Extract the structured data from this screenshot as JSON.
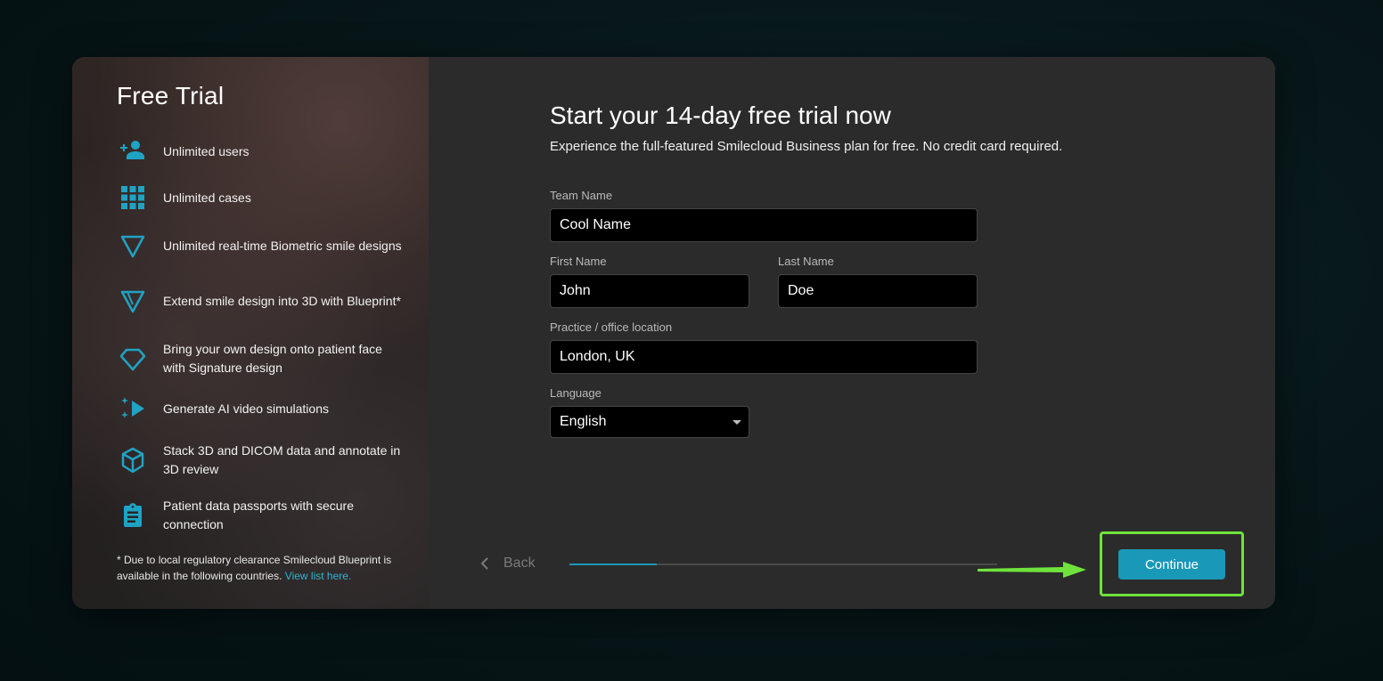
{
  "sidebar": {
    "title": "Free Trial",
    "features": [
      {
        "icon": "add-user-icon",
        "label": "Unlimited users"
      },
      {
        "icon": "grid-icon",
        "label": "Unlimited cases"
      },
      {
        "icon": "triangle-icon",
        "label": "Unlimited real-time Biometric smile designs"
      },
      {
        "icon": "blueprint-triangle-icon",
        "label": "Extend smile design into 3D with Blueprint*"
      },
      {
        "icon": "diamond-icon",
        "label": "Bring your own design onto patient face with Signature design"
      },
      {
        "icon": "sparkle-play-icon",
        "label": "Generate AI video simulations"
      },
      {
        "icon": "cube-icon",
        "label": "Stack 3D and DICOM data and annotate in 3D review"
      },
      {
        "icon": "clipboard-icon",
        "label": "Patient data passports with secure connection"
      }
    ],
    "footnote": "* Due to local regulatory clearance Smilecloud Blueprint is available in the following countries.",
    "footnote_link": "View list here."
  },
  "form": {
    "heading": "Start your 14-day free trial now",
    "subheading": "Experience the full-featured Smilecloud Business plan for free. No credit card required.",
    "team_name": {
      "label": "Team Name",
      "value": "Cool Name"
    },
    "first_name": {
      "label": "First Name",
      "value": "John"
    },
    "last_name": {
      "label": "Last Name",
      "value": "Doe"
    },
    "location": {
      "label": "Practice / office location",
      "value": "London, UK"
    },
    "language": {
      "label": "Language",
      "value": "English"
    }
  },
  "footer": {
    "back_label": "Back",
    "continue_label": "Continue",
    "progress": 0.205
  },
  "colors": {
    "accent": "#1a98b8",
    "icon": "#1fa3c4",
    "highlight": "#6fe33c"
  }
}
